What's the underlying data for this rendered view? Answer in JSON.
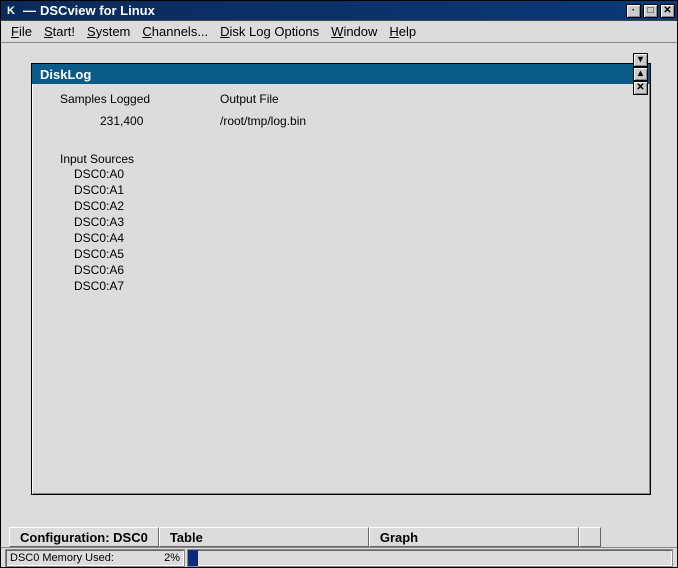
{
  "window": {
    "title": "DSCview for Linux",
    "app_icon_label": "K"
  },
  "menu": {
    "file": "File",
    "start": "Start!",
    "system": "System",
    "channels": "Channels...",
    "disk_log": "Disk Log Options",
    "window": "Window",
    "help": "Help"
  },
  "disklog": {
    "title": "DiskLog",
    "samples_label": "Samples Logged",
    "samples_value": "231,400",
    "output_label": "Output File",
    "output_value": "/root/tmp/log.bin",
    "input_sources_label": "Input Sources",
    "sources": [
      "DSC0:A0",
      "DSC0:A1",
      "DSC0:A2",
      "DSC0:A3",
      "DSC0:A4",
      "DSC0:A5",
      "DSC0:A6",
      "DSC0:A7"
    ]
  },
  "tabs": {
    "config": "Configuration: DSC0",
    "table": "Table",
    "graph": "Graph"
  },
  "status": {
    "label": "DSC0 Memory Used:",
    "pct_text": "2%",
    "pct_value": 2
  }
}
